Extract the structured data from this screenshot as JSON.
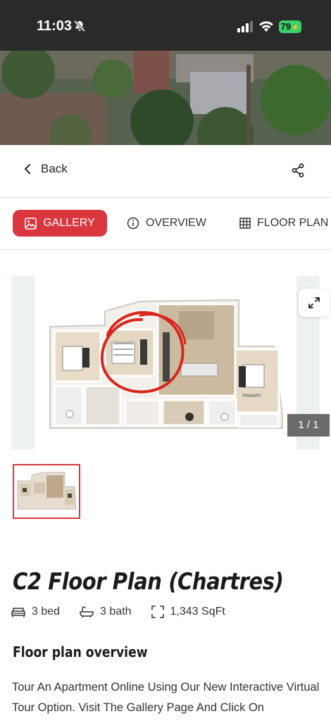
{
  "status_bar": {
    "time": "11:03",
    "battery": "79",
    "icons": [
      "bell-slash-icon",
      "cellular-signal-icon",
      "wifi-icon",
      "battery-charging-icon"
    ]
  },
  "nav": {
    "back_label": "Back",
    "icons": [
      "chevron-left-icon",
      "share-icon"
    ]
  },
  "tabs": [
    {
      "label": "GALLERY",
      "icon": "image-icon",
      "active": true
    },
    {
      "label": "OVERVIEW",
      "icon": "info-circle-icon",
      "active": false
    },
    {
      "label": "FLOOR PLAN /",
      "icon": "grid-icon",
      "active": false
    }
  ],
  "gallery": {
    "counter": "1 / 1",
    "floorplan_room_label": "PRIMARY",
    "icons": [
      "expand-icon"
    ]
  },
  "plan": {
    "title": "C2 Floor Plan (Chartres)",
    "facts": [
      {
        "icon": "bed-icon",
        "label": "3 bed"
      },
      {
        "icon": "bathtub-icon",
        "label": "3 bath"
      },
      {
        "icon": "area-icon",
        "label": "1,343 SqFt"
      }
    ]
  },
  "overview": {
    "heading": "Floor plan overview",
    "text": "Tour An Apartment Online Using Our New Interactive Virtual Tour Option. Visit The Gallery Page And Click On"
  },
  "colors": {
    "accent": "#d9363e",
    "status_bar": "#2a2a2a",
    "battery": "#3ad06a"
  }
}
